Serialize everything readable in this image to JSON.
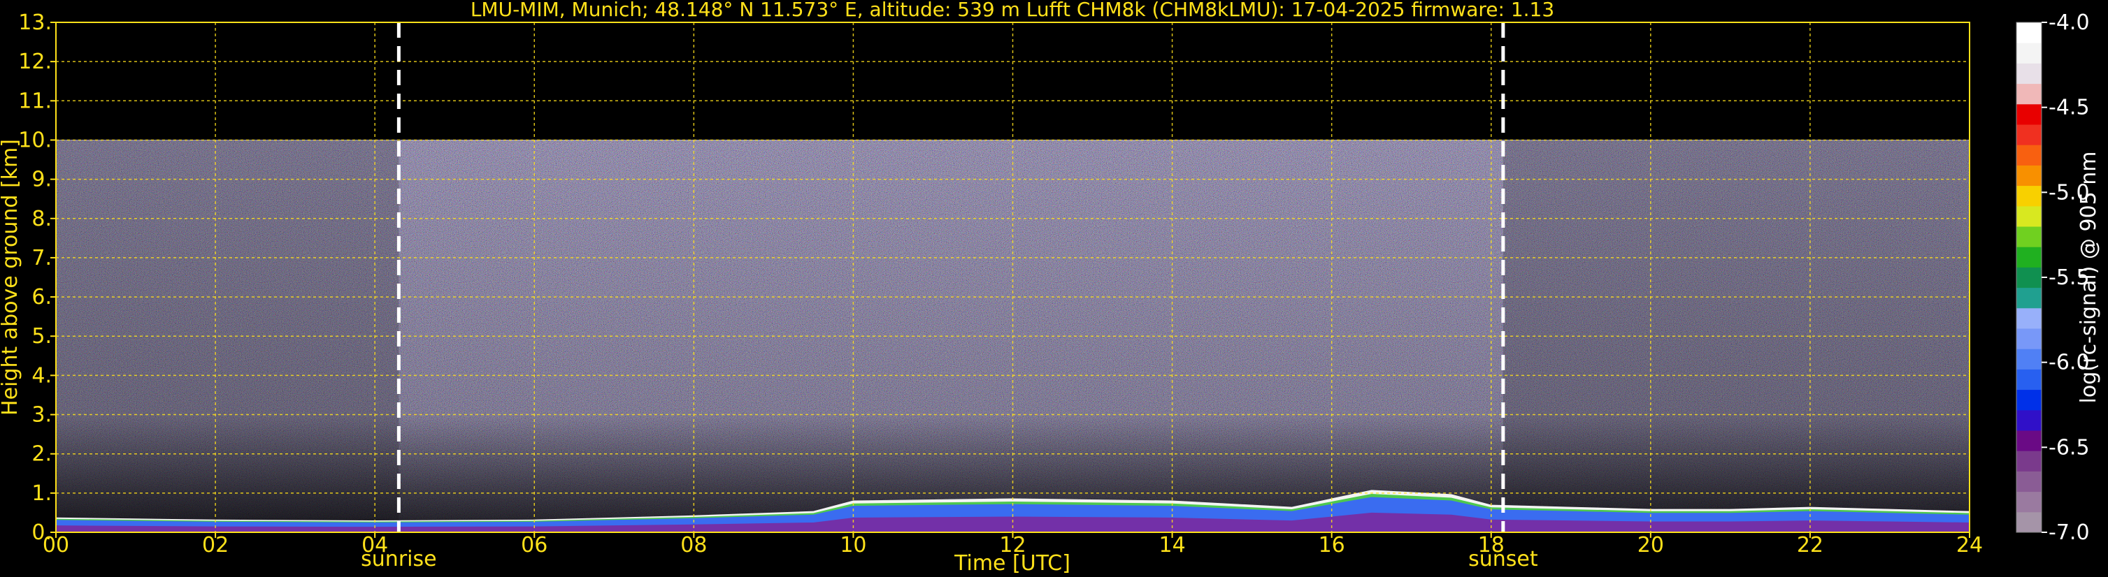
{
  "chart_data": {
    "type": "heatmap",
    "title": "LMU-MIM, Munich; 48.148° N 11.573° E, altitude: 539 m    Lufft CHM8k (CHM8kLMU): 17-04-2025    firmware: 1.13",
    "xlabel": "Time [UTC]",
    "ylabel": "Height above ground [km]",
    "xlim": [
      0,
      24
    ],
    "ylim": [
      0,
      13
    ],
    "x_ticks": [
      "00",
      "02",
      "04",
      "06",
      "08",
      "10",
      "12",
      "14",
      "16",
      "18",
      "20",
      "22",
      "24"
    ],
    "y_ticks": [
      "0.",
      "1.",
      "2.",
      "3.",
      "4.",
      "5.",
      "6.",
      "7.",
      "8.",
      "9.",
      "10.",
      "11.",
      "12.",
      "13."
    ],
    "grid": true,
    "data_extent_height_km": 10,
    "annotations": [
      {
        "label": "sunrise",
        "time_utc": 4.3
      },
      {
        "label": "sunset",
        "time_utc": 18.15
      }
    ],
    "boundary_layer": {
      "time_utc": [
        0,
        2,
        4,
        6,
        8,
        9.5,
        10,
        12,
        14,
        15.5,
        16.5,
        17.5,
        18,
        19,
        20,
        21,
        22,
        23,
        24
      ],
      "top_height_km": [
        0.35,
        0.3,
        0.28,
        0.3,
        0.4,
        0.5,
        0.75,
        0.8,
        0.75,
        0.6,
        1.0,
        0.9,
        0.65,
        0.6,
        0.55,
        0.55,
        0.6,
        0.55,
        0.5
      ]
    },
    "colorbar": {
      "label": "log(rc-signal) @ 905 nm",
      "range": [
        -7.0,
        -4.0
      ],
      "ticks": [
        "-4.0",
        "-4.5",
        "-5.0",
        "-5.5",
        "-6.0",
        "-6.5",
        "-7.0"
      ],
      "colors": [
        "#a594a8",
        "#9a7aa0",
        "#8a5c95",
        "#7a3a8c",
        "#6a0a85",
        "#3010c8",
        "#0030e8",
        "#2860f0",
        "#5080f5",
        "#7898f8",
        "#98b0fa",
        "#20a090",
        "#109050",
        "#20b020",
        "#70d020",
        "#d8e820",
        "#f8d000",
        "#f89000",
        "#f86010",
        "#f03020",
        "#e80000",
        "#f0b8b8",
        "#e8e0e8",
        "#f4f4f4",
        "#ffffff"
      ]
    }
  }
}
